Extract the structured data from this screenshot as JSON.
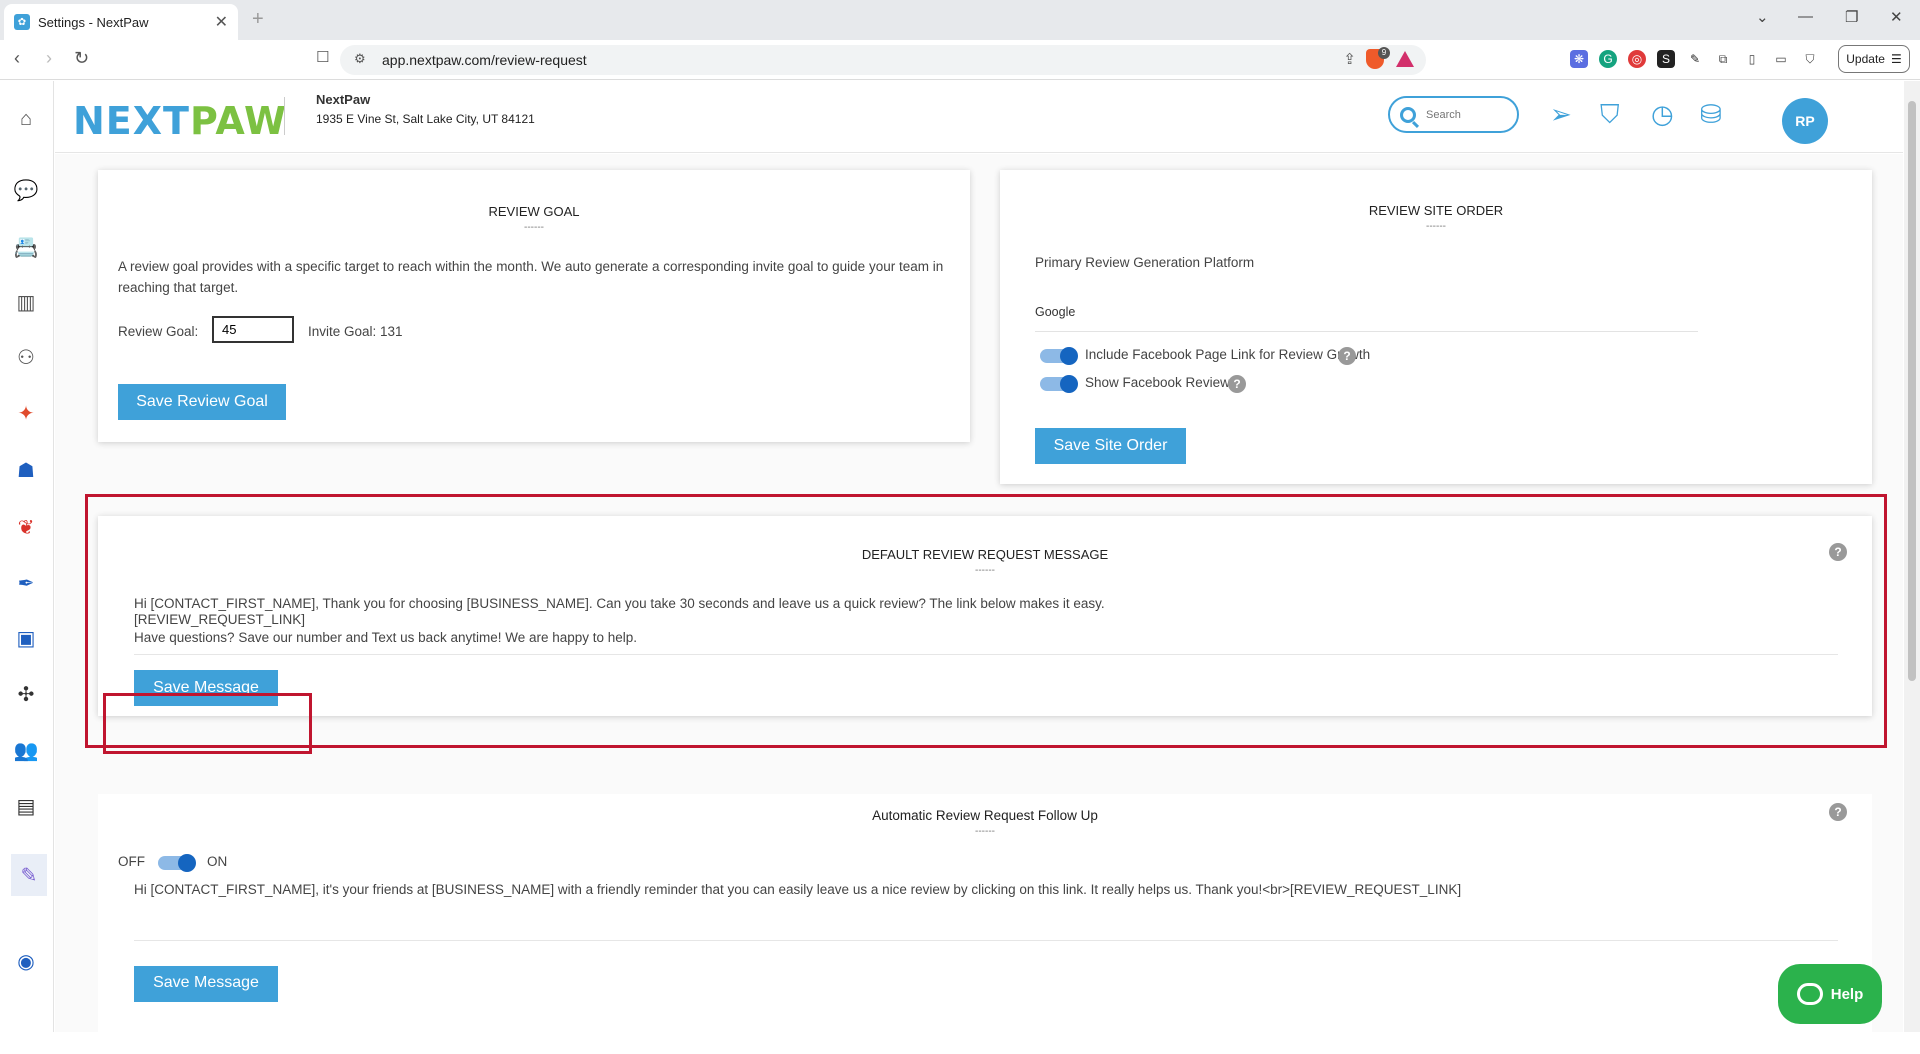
{
  "browser": {
    "tab_title": "Settings - NextPaw",
    "url": "app.nextpaw.com/review-request",
    "update_label": "Update",
    "brave_badge": "9"
  },
  "header": {
    "logo_part1": "NEXT",
    "logo_part2": "PAW",
    "business_name": "NextPaw",
    "business_address": "1935 E Vine St, Salt Lake City, UT 84121",
    "search_placeholder": "Search",
    "avatar_initials": "RP"
  },
  "review_goal": {
    "title": "REVIEW GOAL",
    "divider": "------",
    "description": "A review goal provides with a specific target to reach within the month. We auto generate a corresponding invite goal to guide your team in reaching that target.",
    "review_goal_label": "Review Goal:",
    "review_goal_value": "45",
    "invite_goal_label": "Invite Goal:",
    "invite_goal_value": "131",
    "save_label": "Save Review Goal"
  },
  "review_site_order": {
    "title": "REVIEW SITE ORDER",
    "divider": "------",
    "platform_label": "Primary Review Generation Platform",
    "platform_value": "Google",
    "facebook_link_label": "Include Facebook Page Link for Review Growth",
    "facebook_reviews_label": "Show Facebook Reviews",
    "save_label": "Save Site Order"
  },
  "default_message": {
    "title": "DEFAULT REVIEW REQUEST MESSAGE",
    "divider": "------",
    "line1": "Hi [CONTACT_FIRST_NAME], Thank you for choosing [BUSINESS_NAME]. Can you take 30 seconds and leave us a quick review? The link below makes it easy.",
    "line2": "[REVIEW_REQUEST_LINK]",
    "line3": "Have questions? Save our number and Text us back anytime! We are happy to help.",
    "save_label": "Save Message"
  },
  "follow_up": {
    "title": "Automatic Review Request Follow Up",
    "divider": "------",
    "off_label": "OFF",
    "on_label": "ON",
    "message": "Hi [CONTACT_FIRST_NAME], it's your friends at [BUSINESS_NAME] with a friendly reminder that you can easily leave us a nice review by clicking on this link. It really helps us. Thank you!<br>[REVIEW_REQUEST_LINK]",
    "save_label": "Save Message"
  },
  "help_fab_label": "Help",
  "colors": {
    "accent": "#3fa1d9",
    "brand_green": "#7cc142",
    "highlight_red": "#c0152f",
    "help_green": "#2bb24c"
  }
}
